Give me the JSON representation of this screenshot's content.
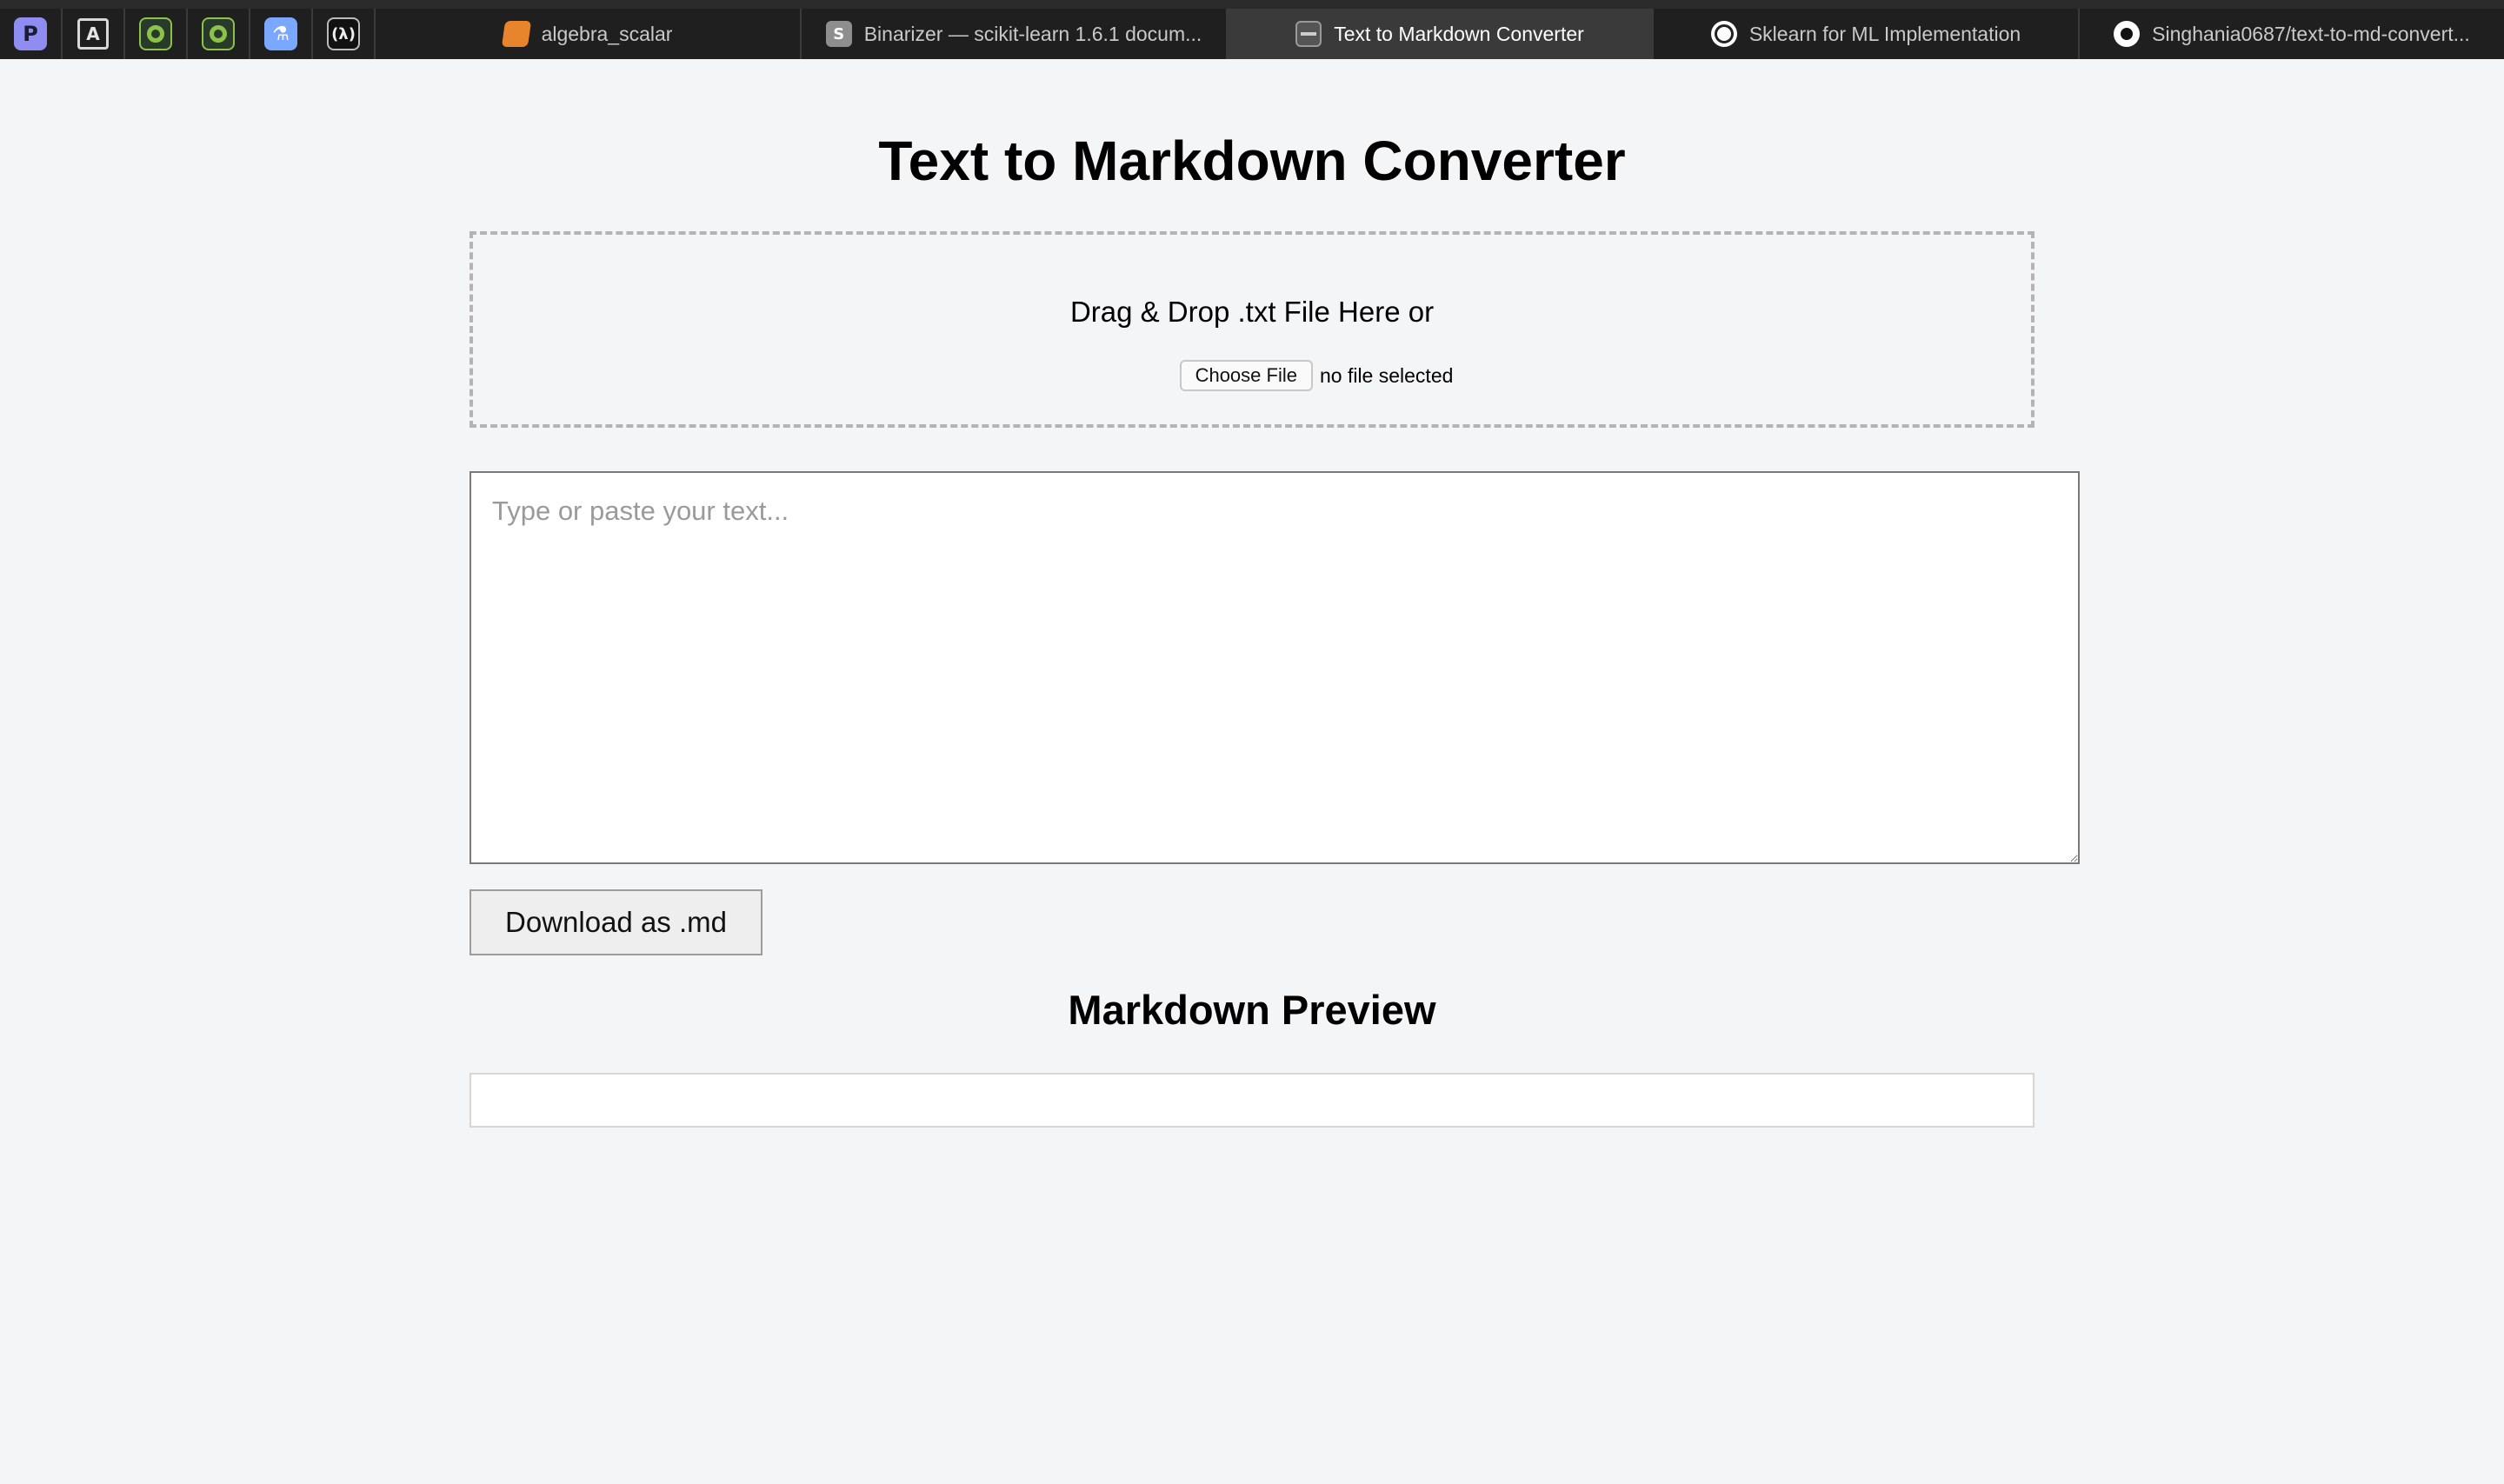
{
  "browser": {
    "pinned_tabs": [
      {
        "icon": "p-logo-icon",
        "glyph": "P"
      },
      {
        "icon": "a-triangle-icon",
        "glyph": "A"
      },
      {
        "icon": "green-ring-icon",
        "glyph": ""
      },
      {
        "icon": "green-ring-icon",
        "glyph": ""
      },
      {
        "icon": "flask-icon",
        "glyph": "⚗"
      },
      {
        "icon": "lambda-icon",
        "glyph": "(λ)"
      }
    ],
    "tabs": [
      {
        "label": "algebra_scalar",
        "icon": "book-icon",
        "active": false
      },
      {
        "label": "Binarizer — scikit-learn 1.6.1 docum...",
        "icon": "s-logo-icon",
        "glyph": "S",
        "active": false
      },
      {
        "label": "Text to Markdown Converter",
        "icon": "markdown-icon",
        "active": true
      },
      {
        "label": "Sklearn for ML Implementation",
        "icon": "chatgpt-icon",
        "active": false
      },
      {
        "label": "Singhania0687/text-to-md-convert...",
        "icon": "github-icon",
        "active": false
      }
    ]
  },
  "page": {
    "title": "Text to Markdown Converter",
    "dropzone": {
      "text": "Drag & Drop .txt File Here or",
      "choose_button": "Choose File",
      "file_status": "no file selected"
    },
    "editor": {
      "placeholder": "Type or paste your text...",
      "value": ""
    },
    "download_button": "Download as .md",
    "preview_heading": "Markdown Preview",
    "preview_content": ""
  }
}
